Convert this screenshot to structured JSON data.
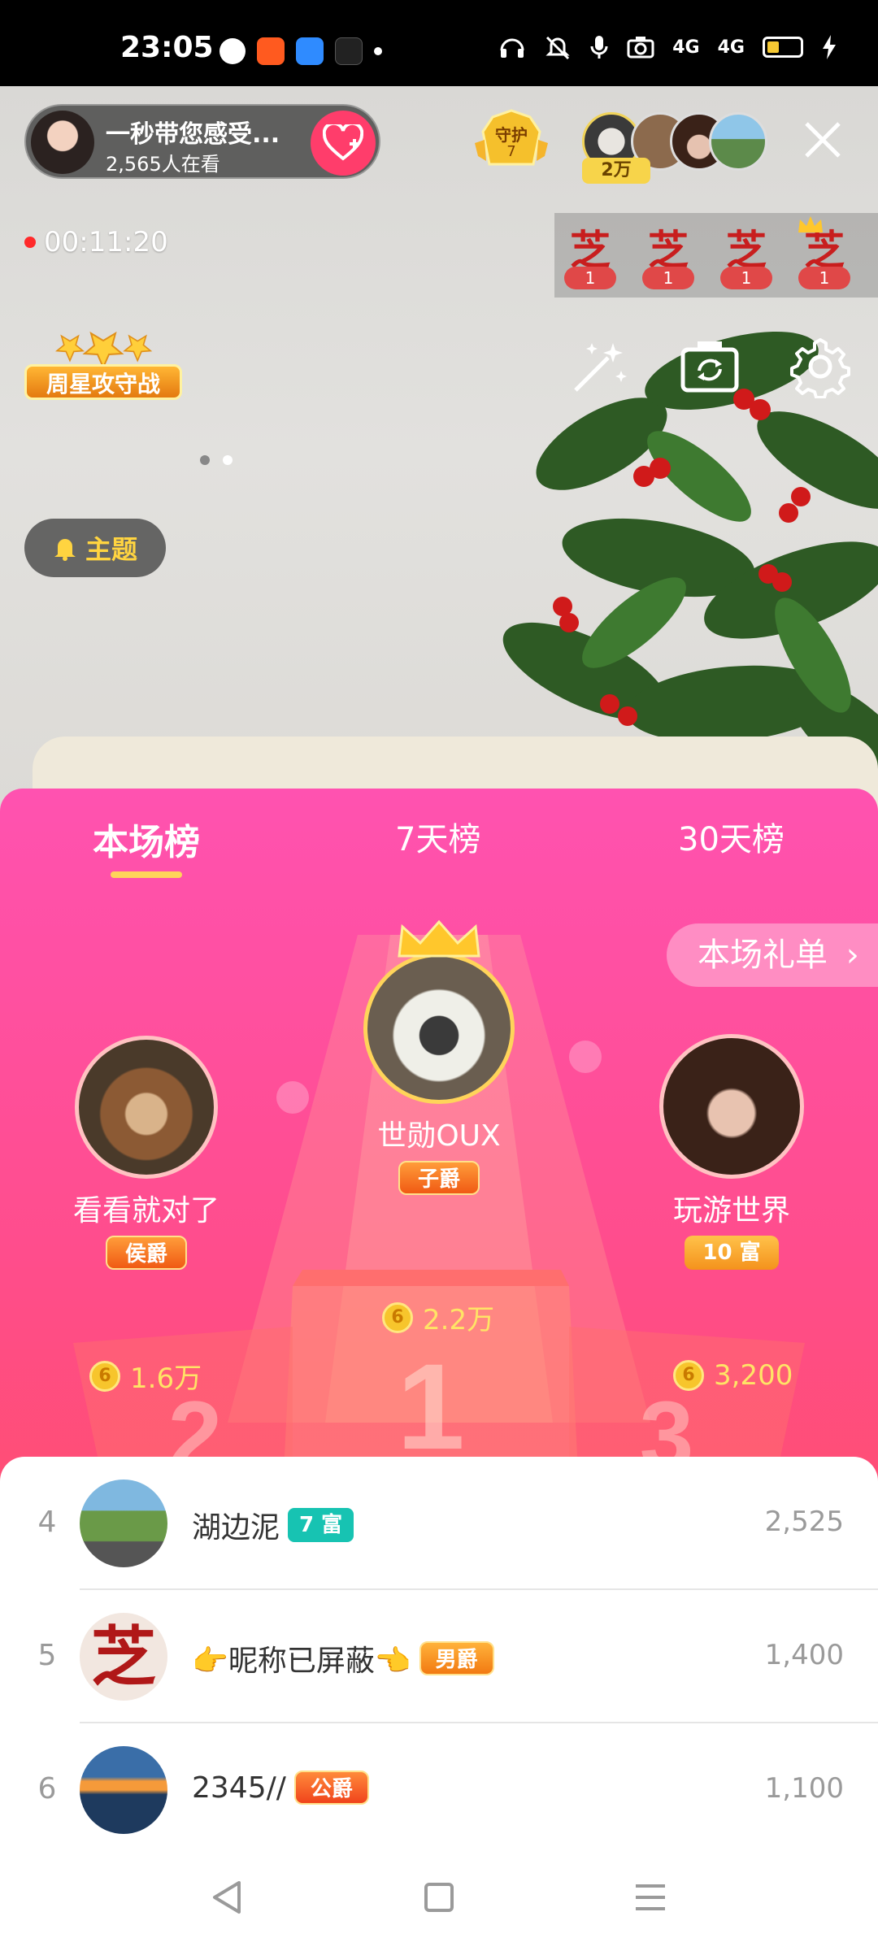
{
  "status_bar": {
    "time": "23:05",
    "network_1": "4G",
    "network_2": "4G"
  },
  "host": {
    "name": "一秒带您感受...",
    "viewers": "2,565人在看"
  },
  "guard": {
    "label": "守护",
    "count": "7"
  },
  "audience": {
    "count_badge": "2万"
  },
  "stream": {
    "timer": "00:11:20"
  },
  "mini_badges": [
    {
      "glyph": "芝",
      "count": "1"
    },
    {
      "glyph": "芝",
      "count": "1"
    },
    {
      "glyph": "芝",
      "count": "1"
    },
    {
      "glyph": "芝",
      "count": "1"
    }
  ],
  "weekly_star": {
    "label": "周星攻守战"
  },
  "topic_button": {
    "label": "主题"
  },
  "ranking": {
    "tabs": [
      "本场榜",
      "7天榜",
      "30天榜"
    ],
    "active_tab": 0,
    "gift_list_label": "本场礼单",
    "top3": [
      {
        "rank": 1,
        "name": "世勋OUX",
        "badge": "子爵",
        "score": "2.2万"
      },
      {
        "rank": 2,
        "name": "看看就对了",
        "badge": "侯爵",
        "score": "1.6万"
      },
      {
        "rank": 3,
        "name": "玩游世界",
        "badge": "10 富",
        "score": "3,200"
      }
    ],
    "podium_numbers": [
      "1",
      "2",
      "3"
    ]
  },
  "list": [
    {
      "rank": "4",
      "name": "湖边泥",
      "tag": "7 富",
      "score": "2,525"
    },
    {
      "rank": "5",
      "name": "👉昵称已屏蔽👈",
      "tag": "男爵",
      "score": "1,400"
    },
    {
      "rank": "6",
      "name": "2345//",
      "tag": "公爵",
      "score": "1,100"
    }
  ],
  "colors": {
    "panel_top": "#ff52b0",
    "panel_bottom": "#ff5a55",
    "accent_gold": "#ffd45a",
    "wealth_teal": "#17c3b2",
    "follow_pink": "#ff3d6b"
  }
}
